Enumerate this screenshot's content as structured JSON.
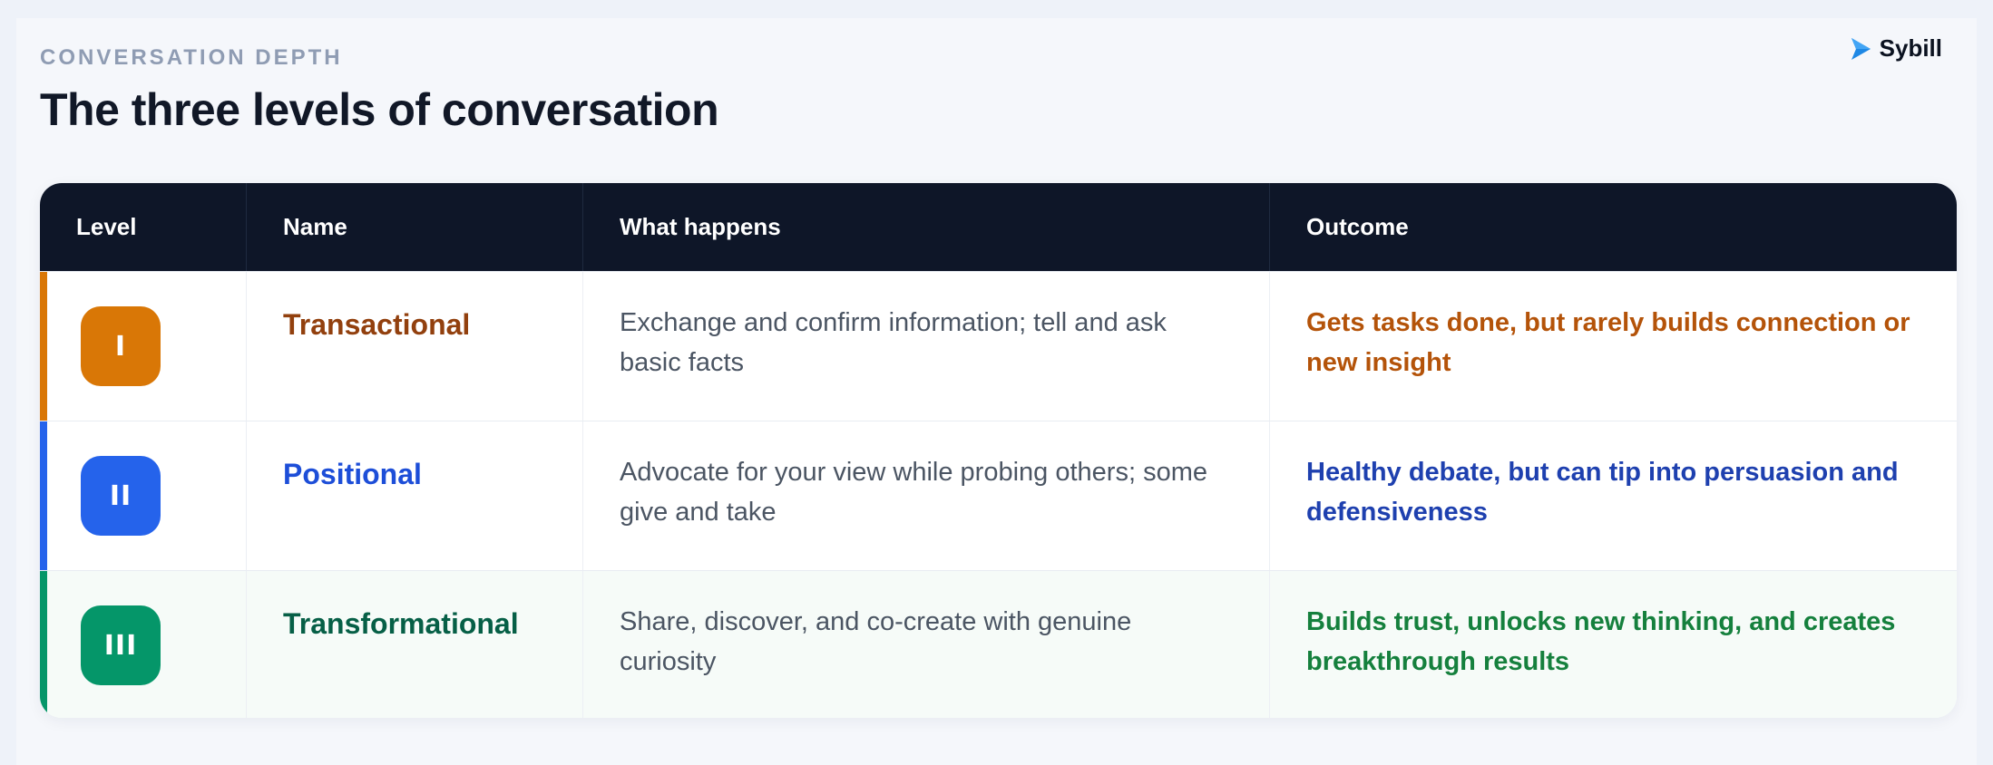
{
  "header": {
    "eyebrow": "CONVERSATION DEPTH",
    "title": "The three levels of conversation"
  },
  "brand": {
    "name": "Sybill",
    "logo_icon": "play-arrow-logo-icon",
    "color": "#1e88e5"
  },
  "table": {
    "columns": [
      "Level",
      "Name",
      "What happens",
      "Outcome"
    ],
    "rows": [
      {
        "badge": "I",
        "name": "Transactional",
        "what": "Exchange and confirm information; tell and ask basic facts",
        "outcome": "Gets tasks done, but rarely builds connection or new insight",
        "colors": {
          "accent": "#d97706",
          "badge": "#d97706",
          "name": "#92400e",
          "outcome": "#b45309"
        }
      },
      {
        "badge": "II",
        "name": "Positional",
        "what": "Advocate for your view while probing others; some give and take",
        "outcome": "Healthy debate, but can tip into persuasion and defensiveness",
        "colors": {
          "accent": "#2563eb",
          "badge": "#2563eb",
          "name": "#1d4ed8",
          "outcome": "#1e40af"
        }
      },
      {
        "badge": "III",
        "name": "Transformational",
        "what": "Share, discover, and co-create with genuine curiosity",
        "outcome": "Builds trust, unlocks new thinking, and creates breakthrough results",
        "colors": {
          "accent": "#059669",
          "badge": "#059669",
          "name": "#065f46",
          "outcome": "#15803d"
        }
      }
    ]
  }
}
